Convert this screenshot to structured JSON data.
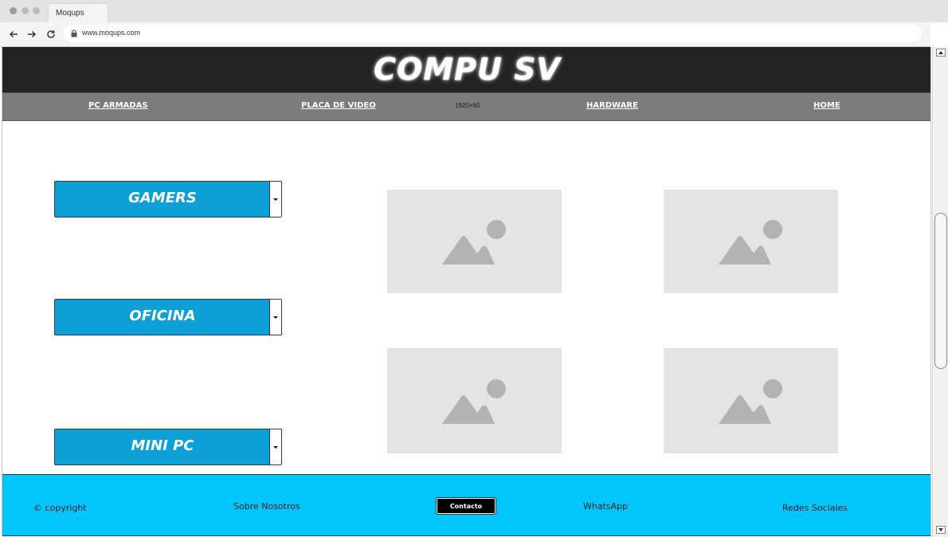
{
  "browser": {
    "tab_title": "Moqups",
    "url": "www.moqups.com"
  },
  "header": {
    "brand": "COMPU SV"
  },
  "navbar": {
    "items": [
      "PC ARMADAS",
      "PLACA DE VIDEO",
      "HARDWARE",
      "HOME"
    ],
    "dimension_label": "1920×60"
  },
  "categories": [
    "GAMERS",
    "OFICINA",
    "MINI PC"
  ],
  "footer": {
    "copyright": "© copyright",
    "about": "Sobre Nosotros",
    "contact": "Contacto",
    "whatsapp": "WhatsApp",
    "social": "Redes Sociales"
  },
  "colors": {
    "header_bg": "#232323",
    "navbar_bg": "#7b7b7b",
    "category_bg": "#0ca0d6",
    "footer_bg": "#00c6fb",
    "placeholder_bg": "#e4e4e4"
  },
  "icons": [
    "back-arrow-icon",
    "forward-arrow-icon",
    "reload-icon",
    "lock-icon",
    "image-placeholder-icon",
    "dropdown-caret-icon"
  ]
}
